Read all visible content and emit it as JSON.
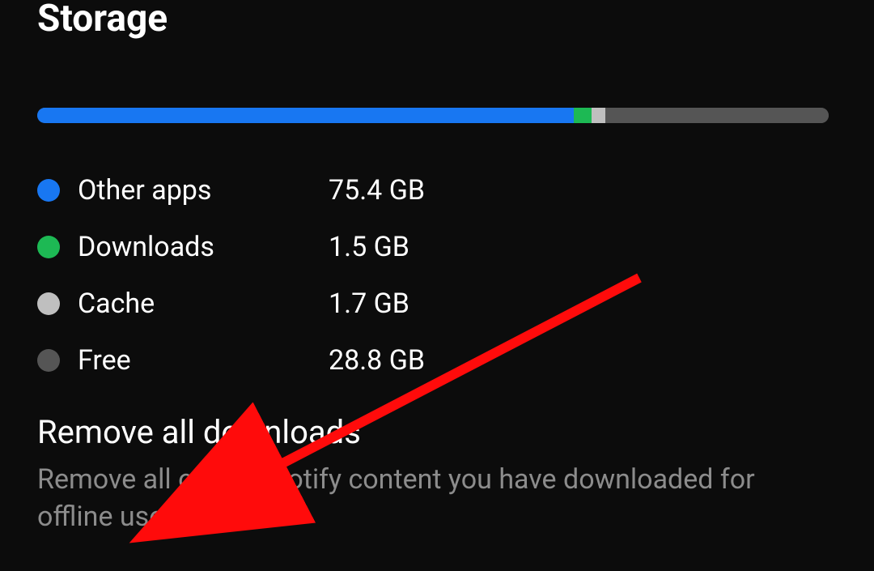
{
  "title": "Storage",
  "bar": {
    "segments": [
      {
        "key": "other",
        "color": "#1877F2",
        "label": "Other apps",
        "value": "75.4 GB",
        "fraction": 0.678
      },
      {
        "key": "downloads",
        "color": "#1DB954",
        "label": "Downloads",
        "value": "1.5 GB",
        "fraction": 0.022
      },
      {
        "key": "cache",
        "color": "#bfbfbf",
        "label": "Cache",
        "value": "1.7 GB",
        "fraction": 0.018
      },
      {
        "key": "free",
        "color": "#555555",
        "label": "Free",
        "value": "28.8 GB",
        "fraction": 0.282
      }
    ]
  },
  "legend": [
    {
      "dot": "#1877F2",
      "label": "Other apps",
      "value": "75.4 GB"
    },
    {
      "dot": "#1DB954",
      "label": "Downloads",
      "value": "1.5 GB"
    },
    {
      "dot": "#bfbfbf",
      "label": "Cache",
      "value": "1.7 GB"
    },
    {
      "dot": "#555555",
      "label": "Free",
      "value": "28.8 GB"
    }
  ],
  "remove": {
    "title": "Remove all downloads",
    "subtitle": "Remove all of the Spotify content you have downloaded for offline use."
  },
  "annotation": {
    "arrow_color": "#ff0b0b"
  }
}
